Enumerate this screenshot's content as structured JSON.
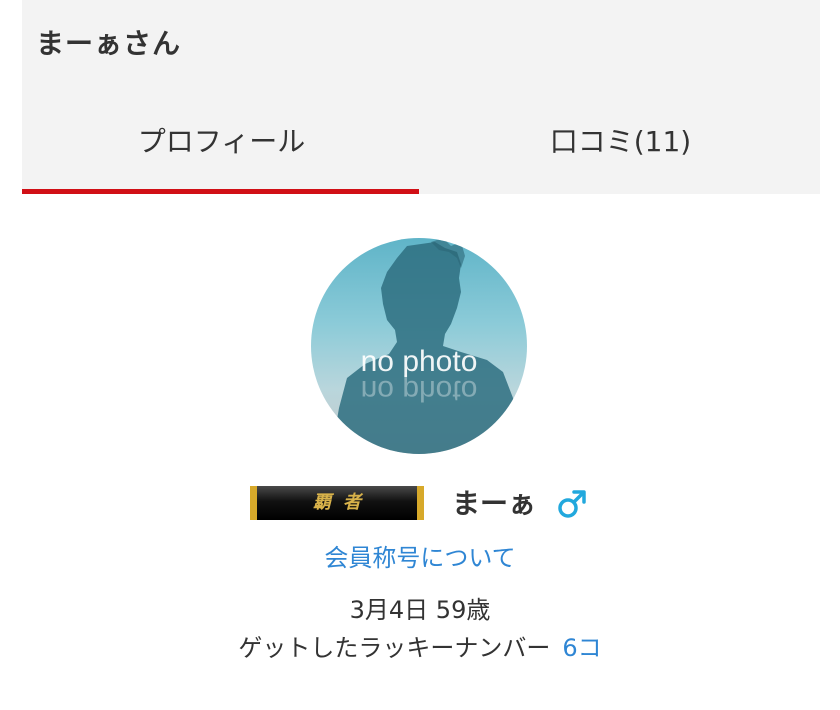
{
  "page_title": "まーぁさん",
  "tabs": [
    {
      "label": "プロフィール",
      "active": true
    },
    {
      "label": "口コミ(11)",
      "active": false
    }
  ],
  "accent_color": "#d10f16",
  "link_color": "#2f86d4",
  "profile": {
    "avatar_text": "no photo",
    "title_badge": "覇者",
    "username": "まーぁ",
    "gender_icon": "male-icon",
    "member_title_link": "会員称号について",
    "birthday_age": "3月4日 59歳",
    "lucky_label": "ゲットしたラッキーナンバー",
    "lucky_count": "6コ"
  }
}
